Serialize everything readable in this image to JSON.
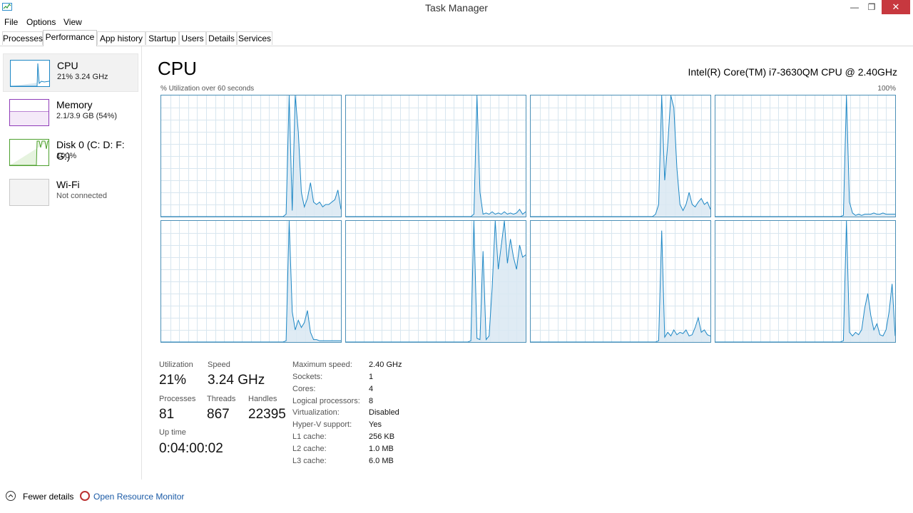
{
  "window": {
    "title": "Task Manager"
  },
  "menu": [
    "File",
    "Options",
    "View"
  ],
  "tabs": [
    "Processes",
    "Performance",
    "App history",
    "Startup",
    "Users",
    "Details",
    "Services"
  ],
  "active_tab": "Performance",
  "sidebar": [
    {
      "title": "CPU",
      "sub": "21%  3.24 GHz",
      "color": "#1d87c5"
    },
    {
      "title": "Memory",
      "sub": "2.1/3.9 GB (54%)",
      "color": "#8f3bb8"
    },
    {
      "title": "Disk 0 (C: D: F: G:)",
      "sub": "100%",
      "color": "#4da02e"
    },
    {
      "title": "Wi-Fi",
      "sub": "Not connected",
      "color": "#aaaaaa"
    }
  ],
  "cpu": {
    "title": "CPU",
    "model": "Intel(R) Core(TM) i7-3630QM CPU @ 2.40GHz",
    "graph_label": "% Utilization over 60 seconds",
    "graph_max": "100%",
    "stats": {
      "utilization": {
        "label": "Utilization",
        "value": "21%"
      },
      "speed": {
        "label": "Speed",
        "value": "3.24 GHz"
      },
      "processes": {
        "label": "Processes",
        "value": "81"
      },
      "threads": {
        "label": "Threads",
        "value": "867"
      },
      "handles": {
        "label": "Handles",
        "value": "22395"
      },
      "uptime": {
        "label": "Up time",
        "value": "0:04:00:02"
      }
    },
    "specs": [
      {
        "label": "Maximum speed:",
        "value": "2.40 GHz"
      },
      {
        "label": "Sockets:",
        "value": "1"
      },
      {
        "label": "Cores:",
        "value": "4"
      },
      {
        "label": "Logical processors:",
        "value": "8"
      },
      {
        "label": "Virtualization:",
        "value": "Disabled"
      },
      {
        "label": "Hyper-V support:",
        "value": "Yes"
      },
      {
        "label": "L1 cache:",
        "value": "256 KB"
      },
      {
        "label": "L2 cache:",
        "value": "1.0 MB"
      },
      {
        "label": "L3 cache:",
        "value": "6.0 MB"
      }
    ]
  },
  "footer": {
    "fewer_details": "Fewer details",
    "resource_monitor": "Open Resource Monitor"
  },
  "colors": {
    "graph_line": "#1d87c5",
    "graph_fill": "#d9e8f2",
    "grid": "#d8e6ef",
    "close_button": "#c7383f",
    "link": "#1a5aa6"
  },
  "chart_data": {
    "type": "area",
    "graph_label": "% Utilization over 60 seconds",
    "ylim": [
      0,
      100
    ],
    "series": [
      {
        "values": [
          0,
          0,
          0,
          0,
          0,
          0,
          0,
          0,
          0,
          0,
          0,
          0,
          0,
          0,
          0,
          0,
          0,
          0,
          0,
          0,
          0,
          0,
          0,
          0,
          0,
          0,
          0,
          0,
          0,
          0,
          0,
          0,
          0,
          0,
          0,
          0,
          0,
          0,
          0,
          0,
          0,
          2,
          100,
          5,
          100,
          70,
          20,
          8,
          15,
          28,
          12,
          10,
          12,
          8,
          10,
          10,
          12,
          14,
          22,
          6
        ]
      },
      {
        "values": [
          0,
          0,
          0,
          0,
          0,
          0,
          0,
          0,
          0,
          0,
          0,
          0,
          0,
          0,
          0,
          0,
          0,
          0,
          0,
          0,
          0,
          0,
          0,
          0,
          0,
          0,
          0,
          0,
          0,
          0,
          0,
          0,
          0,
          0,
          0,
          0,
          0,
          0,
          0,
          0,
          0,
          0,
          2,
          100,
          20,
          2,
          3,
          2,
          4,
          2,
          3,
          2,
          4,
          2,
          3,
          2,
          3,
          6,
          2,
          4
        ]
      },
      {
        "values": [
          0,
          0,
          0,
          0,
          0,
          0,
          0,
          0,
          0,
          0,
          0,
          0,
          0,
          0,
          0,
          0,
          0,
          0,
          0,
          0,
          0,
          0,
          0,
          0,
          0,
          0,
          0,
          0,
          0,
          0,
          0,
          0,
          0,
          0,
          0,
          0,
          0,
          0,
          0,
          0,
          0,
          2,
          10,
          100,
          30,
          60,
          100,
          90,
          40,
          10,
          5,
          10,
          20,
          10,
          8,
          12,
          15,
          10,
          12,
          6
        ]
      },
      {
        "values": [
          0,
          0,
          0,
          0,
          0,
          0,
          0,
          0,
          0,
          0,
          0,
          0,
          0,
          0,
          0,
          0,
          0,
          0,
          0,
          0,
          0,
          0,
          0,
          0,
          0,
          0,
          0,
          0,
          0,
          0,
          0,
          0,
          0,
          0,
          0,
          0,
          0,
          0,
          0,
          0,
          0,
          0,
          1,
          100,
          12,
          3,
          1,
          2,
          1,
          2,
          2,
          2,
          3,
          2,
          2,
          3,
          2,
          2,
          2,
          2
        ]
      },
      {
        "values": [
          0,
          0,
          0,
          0,
          0,
          0,
          0,
          0,
          0,
          0,
          0,
          0,
          0,
          0,
          0,
          0,
          0,
          0,
          0,
          0,
          0,
          0,
          0,
          0,
          0,
          0,
          0,
          0,
          0,
          0,
          0,
          0,
          0,
          0,
          0,
          0,
          0,
          0,
          0,
          0,
          0,
          1,
          100,
          25,
          10,
          18,
          12,
          16,
          26,
          8,
          2,
          2,
          1,
          1,
          1,
          1,
          1,
          1,
          1,
          1
        ]
      },
      {
        "values": [
          0,
          0,
          0,
          0,
          0,
          0,
          0,
          0,
          0,
          0,
          0,
          0,
          0,
          0,
          0,
          0,
          0,
          0,
          0,
          0,
          0,
          0,
          0,
          0,
          0,
          0,
          0,
          0,
          0,
          0,
          0,
          0,
          0,
          0,
          0,
          0,
          0,
          0,
          0,
          0,
          0,
          1,
          100,
          3,
          2,
          75,
          2,
          5,
          45,
          100,
          60,
          80,
          100,
          65,
          85,
          70,
          60,
          80,
          70,
          72
        ]
      },
      {
        "values": [
          0,
          0,
          0,
          0,
          0,
          0,
          0,
          0,
          0,
          0,
          0,
          0,
          0,
          0,
          0,
          0,
          0,
          0,
          0,
          0,
          0,
          0,
          0,
          0,
          0,
          0,
          0,
          0,
          0,
          0,
          0,
          0,
          0,
          0,
          0,
          0,
          0,
          0,
          0,
          0,
          0,
          0,
          1,
          92,
          4,
          8,
          5,
          10,
          6,
          8,
          7,
          10,
          5,
          6,
          12,
          20,
          8,
          10,
          6,
          5
        ]
      },
      {
        "values": [
          0,
          0,
          0,
          0,
          0,
          0,
          0,
          0,
          0,
          0,
          0,
          0,
          0,
          0,
          0,
          0,
          0,
          0,
          0,
          0,
          0,
          0,
          0,
          0,
          0,
          0,
          0,
          0,
          0,
          0,
          0,
          0,
          0,
          0,
          0,
          0,
          0,
          0,
          0,
          0,
          0,
          0,
          1,
          100,
          8,
          5,
          8,
          6,
          10,
          28,
          40,
          22,
          10,
          15,
          6,
          5,
          10,
          25,
          48,
          5
        ]
      }
    ]
  }
}
